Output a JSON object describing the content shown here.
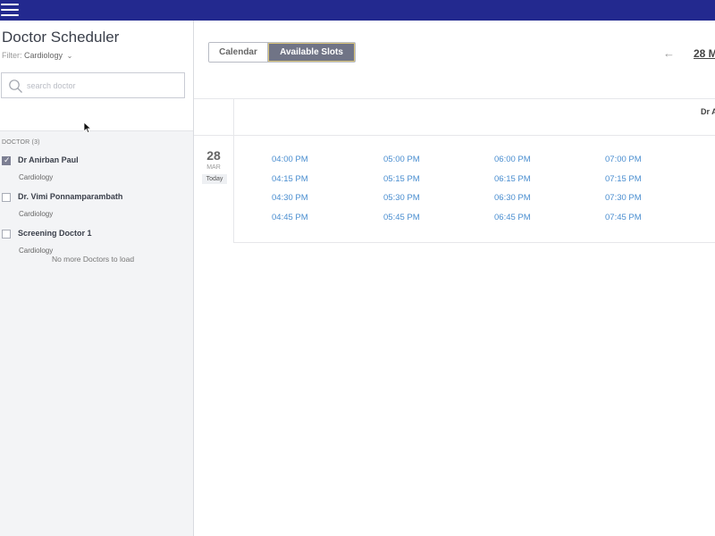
{
  "app": {
    "title": "Doctor Scheduler"
  },
  "filter": {
    "label": "Filter:",
    "value": "Cardiology"
  },
  "search": {
    "placeholder": "search doctor",
    "value": ""
  },
  "doctors": {
    "header": "DOCTOR (3)",
    "items": [
      {
        "name": "Dr Anirban Paul",
        "specialty": "Cardiology",
        "checked": true
      },
      {
        "name": "Dr. Vimi Ponnamparambath",
        "specialty": "Cardiology",
        "checked": false
      },
      {
        "name": "Screening Doctor 1",
        "specialty": "Cardiology",
        "checked": false
      }
    ],
    "footer": "No more Doctors to load"
  },
  "view": {
    "calendar_label": "Calendar",
    "slots_label": "Available Slots",
    "active": "Available Slots"
  },
  "nav": {
    "prev_arrow": "←",
    "date_label": "28 M"
  },
  "grid": {
    "column_header": "Dr A"
  },
  "day": {
    "number": "28",
    "month": "MAR",
    "badge": "Today"
  },
  "slot_columns": [
    [
      "04:00 PM",
      "04:15 PM",
      "04:30 PM",
      "04:45 PM"
    ],
    [
      "05:00 PM",
      "05:15 PM",
      "05:30 PM",
      "05:45 PM"
    ],
    [
      "06:00 PM",
      "06:15 PM",
      "06:30 PM",
      "06:45 PM"
    ],
    [
      "07:00 PM",
      "07:15 PM",
      "07:30 PM",
      "07:45 PM"
    ]
  ],
  "colors": {
    "topbar": "#23298f",
    "accent": "#707486",
    "slot_link": "#4a8ed0"
  }
}
